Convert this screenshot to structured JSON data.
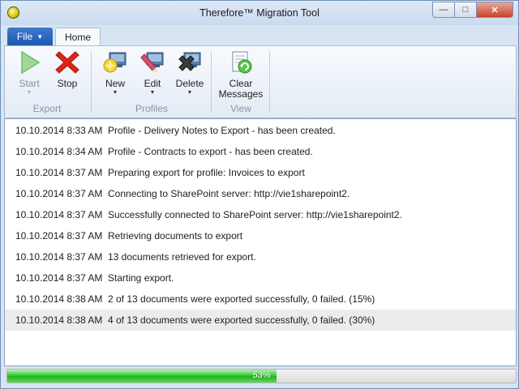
{
  "window": {
    "title": "Therefore™ Migration Tool",
    "controls": {
      "minimize": "—",
      "maximize": "□",
      "close": "✕"
    }
  },
  "tabs": {
    "file_label": "File",
    "file_caret": "▼",
    "home_label": "Home"
  },
  "ribbon": {
    "export": {
      "label": "Export",
      "start": {
        "label": "Start",
        "enabled": false,
        "icon": "play-icon"
      },
      "stop": {
        "label": "Stop",
        "enabled": true,
        "icon": "stop-x-icon"
      }
    },
    "profiles": {
      "label": "Profiles",
      "new": {
        "label": "New",
        "icon": "new-profile-icon"
      },
      "edit": {
        "label": "Edit",
        "icon": "edit-profile-icon"
      },
      "delete": {
        "label": "Delete",
        "icon": "delete-profile-icon"
      },
      "dropdown_glyph": "▼"
    },
    "view": {
      "label": "View",
      "clear": {
        "label_line1": "Clear",
        "label_line2": "Messages",
        "icon": "clear-messages-icon"
      }
    }
  },
  "log": {
    "rows": [
      {
        "time": "10.10.2014 8:33 AM",
        "message": "Profile - Delivery Notes to Export - has been created."
      },
      {
        "time": "10.10.2014 8:34 AM",
        "message": "Profile - Contracts to export - has been created."
      },
      {
        "time": "10.10.2014 8:37 AM",
        "message": "Preparing export for profile: Invoices to export"
      },
      {
        "time": "10.10.2014 8:37 AM",
        "message": "Connecting to SharePoint server: http://vie1sharepoint2."
      },
      {
        "time": "10.10.2014 8:37 AM",
        "message": "Successfully connected to SharePoint server: http://vie1sharepoint2."
      },
      {
        "time": "10.10.2014 8:37 AM",
        "message": "Retrieving documents to export"
      },
      {
        "time": "10.10.2014 8:37 AM",
        "message": "13 documents retrieved for export."
      },
      {
        "time": "10.10.2014 8:37 AM",
        "message": "Starting export."
      },
      {
        "time": "10.10.2014 8:38 AM",
        "message": "2 of 13 documents were exported successfully, 0 failed. (15%)"
      },
      {
        "time": "10.10.2014 8:38 AM",
        "message": "4 of 13 documents were exported successfully, 0 failed. (30%)"
      }
    ],
    "selected_index": 9
  },
  "progress": {
    "percent": 53,
    "text": "53%"
  },
  "colors": {
    "accent": "#1b58b4",
    "progress": "#37c936",
    "stop": "#e0231a",
    "start": "#4fb84a"
  }
}
